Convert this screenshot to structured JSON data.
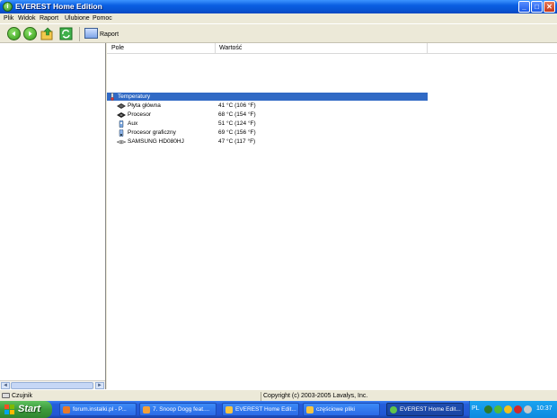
{
  "window": {
    "title": "EVEREST Home Edition",
    "buttons": {
      "minimize": "_",
      "maximize": "□",
      "close": "✕"
    }
  },
  "menu": [
    "Plik",
    "Widok",
    "Raport",
    "Ulubione",
    "Pomoc"
  ],
  "toolbar": {
    "back_icon": "back-arrow-icon",
    "forward_icon": "forward-arrow-icon",
    "up_icon": "up-folder-icon",
    "refresh_icon": "refresh-icon",
    "report_label": "Raport"
  },
  "columns": {
    "field": "Pole",
    "value": "Wartość"
  },
  "group": {
    "label": "Temperatury",
    "icon": "thermometer-icon"
  },
  "rows": [
    {
      "label": "Płyta główna",
      "value": "41 °C  (106 °F)",
      "icon": "motherboard-icon"
    },
    {
      "label": "Procesor",
      "value": "68 °C  (154 °F)",
      "icon": "cpu-icon"
    },
    {
      "label": "Aux",
      "value": "51 °C  (124 °F)",
      "icon": "aux-sensor-icon"
    },
    {
      "label": "Procesor graficzny",
      "value": "69 °C  (156 °F)",
      "icon": "gpu-icon"
    },
    {
      "label": "SAMSUNG HD080HJ",
      "value": "47 °C  (117 °F)",
      "icon": "hard-disk-icon"
    }
  ],
  "status": {
    "left": "Czujnik",
    "right": "Copyright (c) 2003-2005 Lavalys, Inc."
  },
  "taskbar": {
    "start_label": "Start",
    "tasks": [
      {
        "label": "forum.instalki.pl - P...",
        "icon_color": "#e8792b",
        "active": false
      },
      {
        "label": "7. Snoop Dogg feat....",
        "icon_color": "#f2a03a",
        "active": false
      },
      {
        "label": "EVEREST Home Edit...",
        "icon_color": "#f5c542",
        "active": false
      },
      {
        "label": "częściowe pliki",
        "icon_color": "#f5c542",
        "active": false
      },
      {
        "label": "EVEREST Home Edit...",
        "icon_color": "#5fc44a",
        "active": true
      }
    ],
    "language": "PL",
    "clock": "10:37"
  }
}
